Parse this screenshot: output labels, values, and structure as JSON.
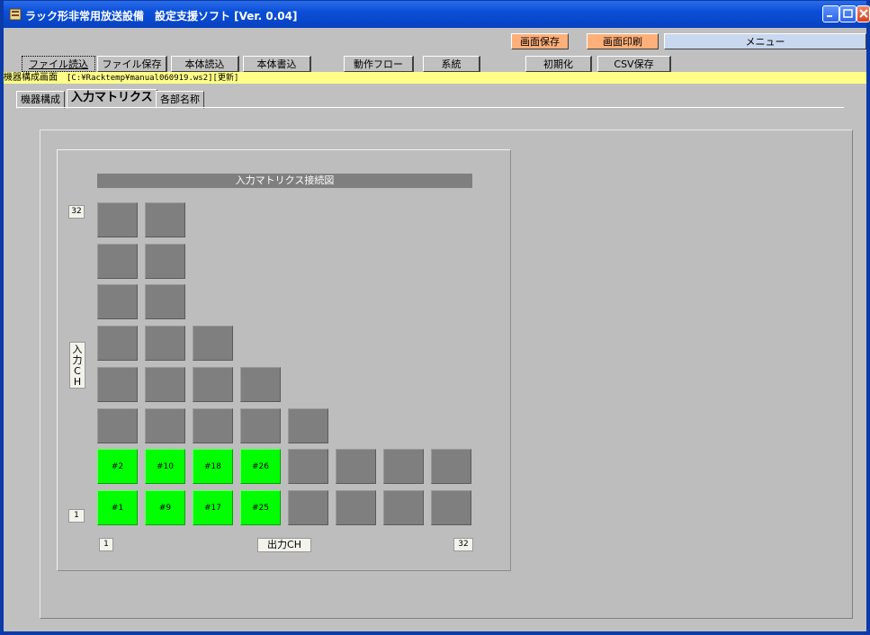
{
  "window": {
    "title": "ラック形非常用放送設備　設定支援ソフト [Ver. 0.04]"
  },
  "top_buttons": {
    "save_screen": "画面保存",
    "print_screen": "画面印刷",
    "menu": "メニュー"
  },
  "toolbar": [
    {
      "name": "file-load-button",
      "label": "ファイル読込"
    },
    {
      "name": "file-save-button",
      "label": "ファイル保存"
    },
    {
      "name": "device-read-button",
      "label": "本体読込"
    },
    {
      "name": "device-write-button",
      "label": "本体書込"
    },
    {
      "name": "operation-flow-button",
      "label": "動作フロー"
    },
    {
      "name": "system-button",
      "label": "系統"
    },
    {
      "name": "initialize-button",
      "label": "初期化"
    },
    {
      "name": "csv-save-button",
      "label": "CSV保存"
    }
  ],
  "path_bar": {
    "label": "機器構成画面",
    "path": "[C:¥Racktemp¥manual060919.ws2][更新]"
  },
  "tabs": [
    {
      "label": "機器構成",
      "selected": false
    },
    {
      "label": "入力マトリクス",
      "selected": true
    },
    {
      "label": "各部名称",
      "selected": false
    }
  ],
  "matrix": {
    "title": "入力マトリクス接続図",
    "input_label": "入力CH",
    "output_label": "出力CH",
    "y_max_label": "32",
    "y_min_label": "1",
    "x_min_label": "1",
    "x_max_label": "32",
    "rows_top_to_bottom": [
      {
        "count": 2,
        "labels": []
      },
      {
        "count": 2,
        "labels": []
      },
      {
        "count": 2,
        "labels": []
      },
      {
        "count": 3,
        "labels": []
      },
      {
        "count": 4,
        "labels": []
      },
      {
        "count": 5,
        "labels": []
      },
      {
        "count": 8,
        "labels": [
          "#2",
          "#10",
          "#18",
          "#26"
        ]
      },
      {
        "count": 8,
        "labels": [
          "#1",
          "#9",
          "#17",
          "#25"
        ]
      }
    ],
    "active_color": "#00ff00",
    "inactive_color": "#7f7f7f"
  }
}
